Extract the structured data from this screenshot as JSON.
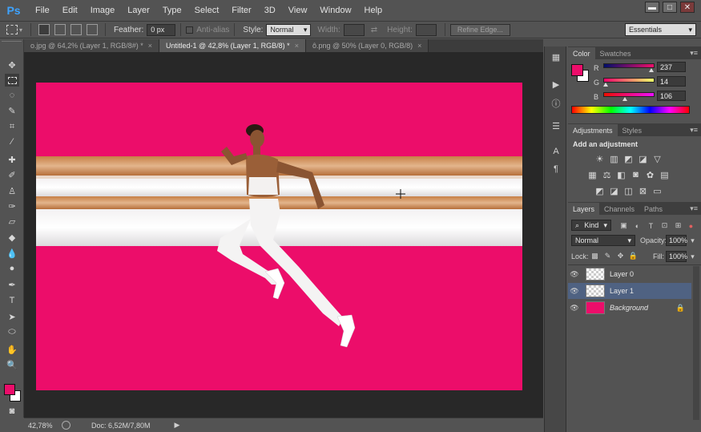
{
  "app": {
    "logo": "Ps"
  },
  "menu": [
    "File",
    "Edit",
    "Image",
    "Layer",
    "Type",
    "Select",
    "Filter",
    "3D",
    "View",
    "Window",
    "Help"
  ],
  "window_controls": {
    "minimize": "▬",
    "maximize": "□",
    "close": "✕"
  },
  "options": {
    "feather_label": "Feather:",
    "feather_value": "0 px",
    "antialias_label": "Anti-alias",
    "style_label": "Style:",
    "style_value": "Normal",
    "width_label": "Width:",
    "height_label": "Height:",
    "refine_edge": "Refine Edge...",
    "workspace": "Essentials"
  },
  "tabs": [
    {
      "label": "o.jpg @ 64,2% (Layer 1, RGB/8#) *",
      "active": false
    },
    {
      "label": "Untitled-1 @ 42,8% (Layer 1, RGB/8) *",
      "active": true
    },
    {
      "label": "ô.png @ 50% (Layer 0, RGB/8)",
      "active": false
    }
  ],
  "tab_close": "×",
  "tools": [
    "move-tool",
    "marquee-tool",
    "lasso-tool",
    "quick-select-tool",
    "crop-tool",
    "eyedropper-tool",
    "healing-brush-tool",
    "brush-tool",
    "clone-stamp-tool",
    "history-brush-tool",
    "eraser-tool",
    "gradient-tool",
    "blur-tool",
    "dodge-tool",
    "pen-tool",
    "type-tool",
    "path-select-tool",
    "shape-tool",
    "hand-tool",
    "zoom-tool"
  ],
  "status": {
    "zoom": "42,78%",
    "doc": "Doc: 6,52M/7,80M"
  },
  "colors": {
    "accent": "#ec0d6a",
    "panel": "#535353",
    "canvas_bg": "#282828"
  },
  "color_panel": {
    "tabs": [
      "Color",
      "Swatches"
    ],
    "channels": [
      {
        "label": "R",
        "value": "237",
        "fraction": 0.93
      },
      {
        "label": "G",
        "value": "14",
        "fraction": 0.05
      },
      {
        "label": "B",
        "value": "106",
        "fraction": 0.42
      }
    ]
  },
  "adjustments_panel": {
    "tabs": [
      "Adjustments",
      "Styles"
    ],
    "heading": "Add an adjustment"
  },
  "layers_panel": {
    "tabs": [
      "Layers",
      "Channels",
      "Paths"
    ],
    "kind": "Kind",
    "blend_mode": "Normal",
    "opacity_label": "Opacity:",
    "opacity_value": "100%",
    "lock_label": "Lock:",
    "fill_label": "Fill:",
    "fill_value": "100%",
    "layers": [
      {
        "name": "Layer 0",
        "selected": false,
        "thumb": "checker",
        "italic": false
      },
      {
        "name": "Layer 1",
        "selected": true,
        "thumb": "checker",
        "italic": false
      },
      {
        "name": "Background",
        "selected": false,
        "thumb": "pink",
        "italic": true,
        "locked": true
      }
    ]
  }
}
